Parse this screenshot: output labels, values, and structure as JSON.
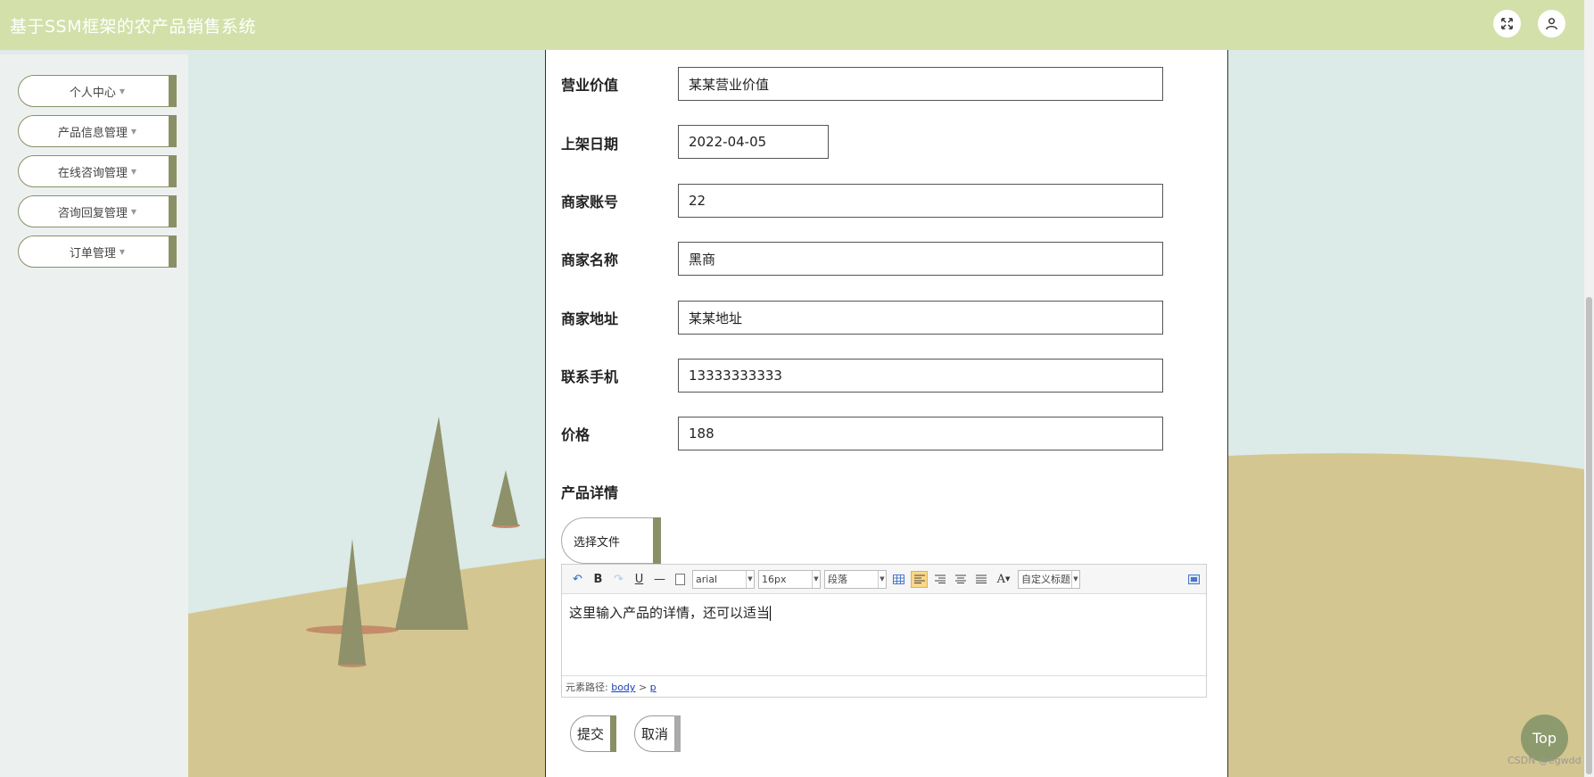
{
  "header": {
    "title": "基于SSM框架的农产品销售系统"
  },
  "sidebar": {
    "items": [
      {
        "label": "个人中心"
      },
      {
        "label": "产品信息管理"
      },
      {
        "label": "在线咨询管理"
      },
      {
        "label": "咨询回复管理"
      },
      {
        "label": "订单管理"
      }
    ]
  },
  "form": {
    "fields": [
      {
        "label": "营业价值",
        "value": "某某营业价值"
      },
      {
        "label": "上架日期",
        "value": "2022-04-05"
      },
      {
        "label": "商家账号",
        "value": "22"
      },
      {
        "label": "商家名称",
        "value": "黑商"
      },
      {
        "label": "商家地址",
        "value": "某某地址"
      },
      {
        "label": "联系手机",
        "value": "13333333333"
      },
      {
        "label": "价格",
        "value": "188"
      }
    ],
    "detail_label": "产品详情",
    "file_button": "选择文件",
    "editor": {
      "font_family": "arial",
      "font_size": "16px",
      "paragraph": "段落",
      "custom_title": "自定义标题",
      "content": "这里输入产品的详情，还可以适当",
      "path_label": "元素路径:",
      "path_body": "body",
      "path_sep": ">",
      "path_p": "p"
    },
    "submit_label": "提交",
    "cancel_label": "取消"
  },
  "top_button": "Top",
  "watermark": "CSDN @egwdd",
  "colors": {
    "topbar": "#d3e0aa",
    "accent": "#8a8f66",
    "top_button": "#8d9a6d"
  }
}
